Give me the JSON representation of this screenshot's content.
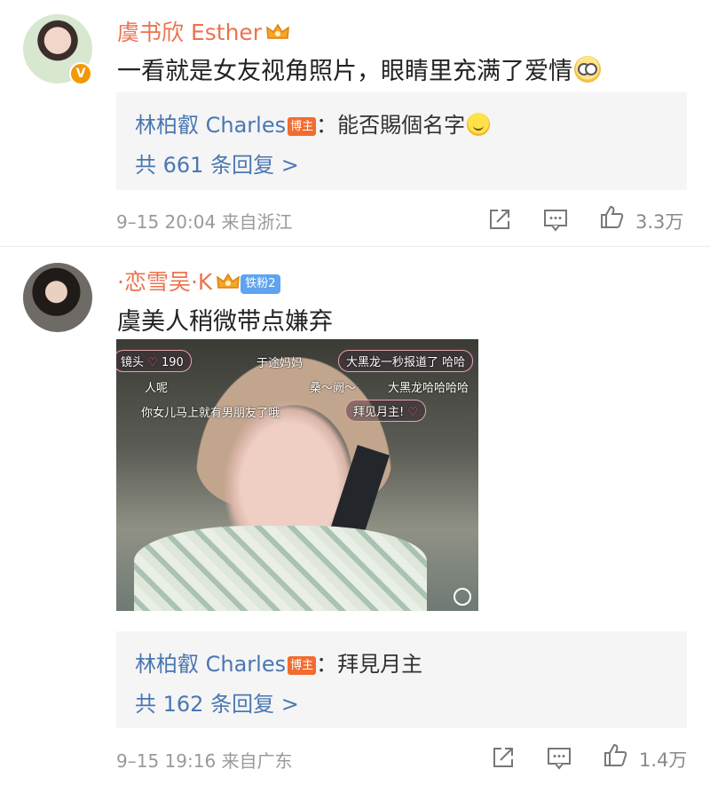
{
  "comments": [
    {
      "username": "虞书欣 Esther",
      "text": "一看就是女友视角照片，眼睛里充满了爱情",
      "verified_badge": "V",
      "reply": {
        "name": "林柏叡 Charles",
        "tag": "博主",
        "separator": "：",
        "text": "能否賜個名字",
        "count_label": "共 661 条回复 >"
      },
      "meta": "9–15 20:04  来自浙江",
      "likes": "3.3万"
    },
    {
      "username": "·恋雪吴·K",
      "fan_badge": "铁粉2",
      "text": "虞美人稍微带点嫌弃",
      "media": {
        "danmaku": [
          "镜头",
          "190",
          "于途妈妈",
          "大黑龙一秒报道了 哈哈",
          "人呢",
          "桑～阙～",
          "大黑龙哈哈哈哈",
          "你女儿马上就有男朋友了哦",
          "拜见月主!"
        ]
      },
      "reply": {
        "name": "林柏叡 Charles",
        "tag": "博主",
        "separator": "：",
        "text": "拜見月主",
        "count_label": "共 162 条回复 >"
      },
      "meta": "9–15 19:16  来自广东",
      "likes": "1.4万"
    }
  ],
  "icons": {
    "share": "share-icon",
    "comment": "comment-icon",
    "like": "thumbs-up-icon",
    "crown": "crown-icon"
  },
  "colors": {
    "username": "#eb7350",
    "link": "#4a77b2",
    "reply_bg": "#f5f5f5",
    "meta": "#9a9a9a",
    "blogger_tag": "#f26b2f",
    "fan_badge": "#5ea4f0"
  }
}
